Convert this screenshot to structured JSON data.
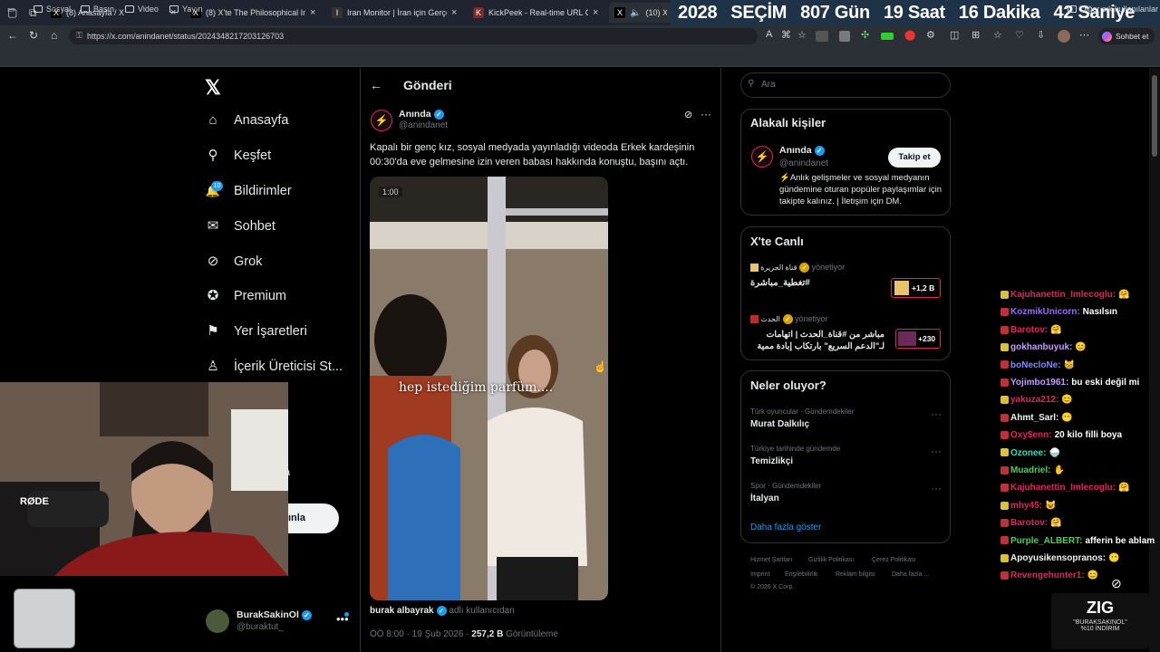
{
  "browser": {
    "tabs": [
      {
        "title": "(8) Anasayfa / X",
        "fav": "X"
      },
      {
        "title": "(8) X'te The Philosophical Investo",
        "fav": "X"
      },
      {
        "title": "Iran Monitor | İran için Gerçek Za",
        "fav": "I"
      },
      {
        "title": "KickPeek - Real-time URL Crawle",
        "fav": "K"
      },
      {
        "title": "(10) X'te",
        "fav": "X"
      }
    ],
    "url": "https://x.com/anindanet/status/2024348217203126703",
    "bookmarks": [
      "Sosyal",
      "Basın",
      "Video",
      "Yayın"
    ],
    "other_bookmarks": "Diğer sık kullanılanlar",
    "copilot_label": "Sohbet et"
  },
  "countdown": {
    "year": "2028",
    "label": "SEÇİM",
    "days": "807 Gün",
    "hours": "19 Saat",
    "minutes": "16 Dakika",
    "seconds": "42 Saniye"
  },
  "nav": {
    "items": [
      {
        "label": "Anasayfa",
        "icon": "home-icon",
        "glyph": "⌂"
      },
      {
        "label": "Keşfet",
        "icon": "search-icon",
        "glyph": "⚲"
      },
      {
        "label": "Bildirimler",
        "icon": "bell-icon",
        "glyph": "🔔"
      },
      {
        "label": "Sohbet",
        "icon": "mail-icon",
        "glyph": "✉"
      },
      {
        "label": "Grok",
        "icon": "grok-icon",
        "glyph": "⊘"
      },
      {
        "label": "Premium",
        "icon": "premium-icon",
        "glyph": "✪"
      },
      {
        "label": "Yer İşaretleri",
        "icon": "bookmark-icon",
        "glyph": "⚑"
      },
      {
        "label": "İçerik Üreticisi St...",
        "icon": "creator-icon",
        "glyph": "♙"
      }
    ],
    "notif_count": "10",
    "post_btn_partial": "ınla",
    "partial_label": "a"
  },
  "header": {
    "title": "Gönderi"
  },
  "tweet": {
    "author": "Anında",
    "handle": "@anindanet",
    "text": "Kapalı bir genç kız, sosyal medyada yayınladığı videoda Erkek kardeşinin 00:30'da eve gelmesine izin veren babası hakkında konuştu, başını açtı.",
    "video_time": "1:00",
    "caption": "hep istediğim parfüm....",
    "video_author": "burak albayrak",
    "video_note": "adlı kullanıcıdan",
    "time": "ÖÖ 8:00 · 19 Şub 2026 · ",
    "views": "257,2 B",
    "views_label": "Görüntüleme"
  },
  "sidebar": {
    "search_placeholder": "Ara",
    "related_title": "Alakalı kişiler",
    "related": {
      "name": "Anında",
      "handle": "@anindanet",
      "follow": "Takip et",
      "bio": "⚡Anlık gelişmeler ve sosyal medyanın gündemine oturan popüler paylaşımlar için takipte kalınız. | İletişim için DM."
    },
    "live_title": "X'te Canlı",
    "live": [
      {
        "host": "قناة الجزيرة",
        "role": "yönetiyor",
        "title": "#تغطية_مباشرة",
        "count": "+1,2 B"
      },
      {
        "host": "الحدث",
        "role": "yönetiyor",
        "title": "مباشر من #قناة_الحدث | اتهامات لـ\"الدعم السريع\" بارتكاب إبادة ممية",
        "count": "+230"
      }
    ],
    "trends_title": "Neler oluyor?",
    "trends": [
      {
        "category": "Türk oyuncular · Gündemdekiler",
        "name": "Murat Dalkılıç"
      },
      {
        "category": "Türkiye tarihinde gündemde",
        "name": "Temizlikçi"
      },
      {
        "category": "Spor · Gündemdekiler",
        "name": "İtalyan"
      }
    ],
    "show_more": "Daha fazla göster",
    "footer": [
      "Hizmet Şartları",
      "Gizlilik Politikası",
      "Çerez Politikası",
      "Imprint",
      "Erişilebilirlik",
      "Reklam bilgisi",
      "Daha fazla ...",
      "© 2026 X Corp."
    ]
  },
  "profile": {
    "name": "BurakSakinOl",
    "handle": "@buraktut_"
  },
  "chat": [
    {
      "user": "Kajuhanettin_Imlecoglu:",
      "msg": "🤗",
      "color": "#e0245e"
    },
    {
      "user": "KozmikUnicorn:",
      "msg": "Nasılsın",
      "color": "#9b6cff"
    },
    {
      "user": "Barotov:",
      "msg": "🤗",
      "color": "#e0245e"
    },
    {
      "user": "gokhanbuyuk:",
      "msg": "😊",
      "color": "#c59cff"
    },
    {
      "user": "boNecloNe:",
      "msg": "😸",
      "color": "#7a8cff"
    },
    {
      "user": "Yojimbo1961:",
      "msg": "bu eski değil mi",
      "color": "#c59cff"
    },
    {
      "user": "yakuza212:",
      "msg": "😊",
      "color": "#e0245e"
    },
    {
      "user": "Ahmt_Sarl:",
      "msg": "😶",
      "color": "#f4f4f4"
    },
    {
      "user": "Oxy$enn:",
      "msg": "20 kilo filli boya",
      "color": "#e0245e"
    },
    {
      "user": "Ozonee:",
      "msg": "🍚",
      "color": "#3fd4c0"
    },
    {
      "user": "Muadriel:",
      "msg": "✋",
      "color": "#3fd45a"
    },
    {
      "user": "Kajuhanettin_Imlecoglu:",
      "msg": "🤗",
      "color": "#e0245e"
    },
    {
      "user": "mhy45:",
      "msg": "😺",
      "color": "#e0245e"
    },
    {
      "user": "Barotov:",
      "msg": "🤗",
      "color": "#e0245e"
    },
    {
      "user": "Purple_ALBERT:",
      "msg": "afferin be ablam",
      "color": "#3fd45a"
    },
    {
      "user": "Apoyusikensopranos:",
      "msg": "😶",
      "color": "#f4f4f4"
    },
    {
      "user": "Revengehunter1:",
      "msg": "😊",
      "color": "#e0245e"
    }
  ],
  "stream_logo": {
    "brand": "ZIG",
    "promo": "\"BURAKSAKINOL\"",
    "discount": "%10 İNDİRİM"
  },
  "webcam": {
    "mic_brand": "RØDE"
  }
}
